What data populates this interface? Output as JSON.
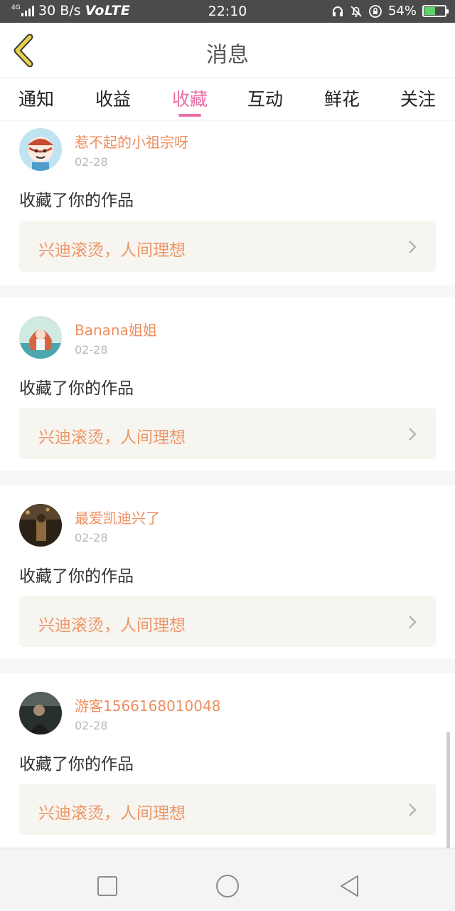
{
  "status_bar": {
    "network_tag": "4G",
    "speed": "30 B/s",
    "volte": "VoLTE",
    "time": "22:10",
    "battery": "54%",
    "battery_level": 0.54,
    "battery_color": "#5fd36b",
    "icons": [
      "headphones-icon",
      "muted-bell-icon",
      "rotation-lock-icon"
    ]
  },
  "header": {
    "back_icon": "chevron-left-icon",
    "back_color": "#e7d44a",
    "title": "消息"
  },
  "tabs": [
    {
      "label": "通知",
      "active": false
    },
    {
      "label": "收益",
      "active": false
    },
    {
      "label": "收藏",
      "active": true
    },
    {
      "label": "互动",
      "active": false
    },
    {
      "label": "鲜花",
      "active": false
    },
    {
      "label": "关注",
      "active": false
    }
  ],
  "accent_color": "#e96fa4",
  "items": [
    {
      "username": "惹不起的小祖宗呀",
      "date": "02-28",
      "action": "收藏了你的作品",
      "work_title": "兴迪滚烫，人间理想",
      "avatar_icon": "cartoon-avatar"
    },
    {
      "username": "Banana姐姐",
      "date": "02-28",
      "action": "收藏了你的作品",
      "work_title": "兴迪滚烫，人间理想",
      "avatar_icon": "illustration-avatar"
    },
    {
      "username": "最爱凯迪兴了",
      "date": "02-28",
      "action": "收藏了你的作品",
      "work_title": "兴迪滚烫，人间理想",
      "avatar_icon": "photo-avatar"
    },
    {
      "username": "游客1566168010048",
      "date": "02-28",
      "action": "收藏了你的作品",
      "work_title": "兴迪滚烫，人间理想",
      "avatar_icon": "photo-avatar"
    }
  ],
  "nav_bar": {
    "recents_icon": "square-icon",
    "home_icon": "circle-icon",
    "back_icon": "triangle-back-icon"
  }
}
